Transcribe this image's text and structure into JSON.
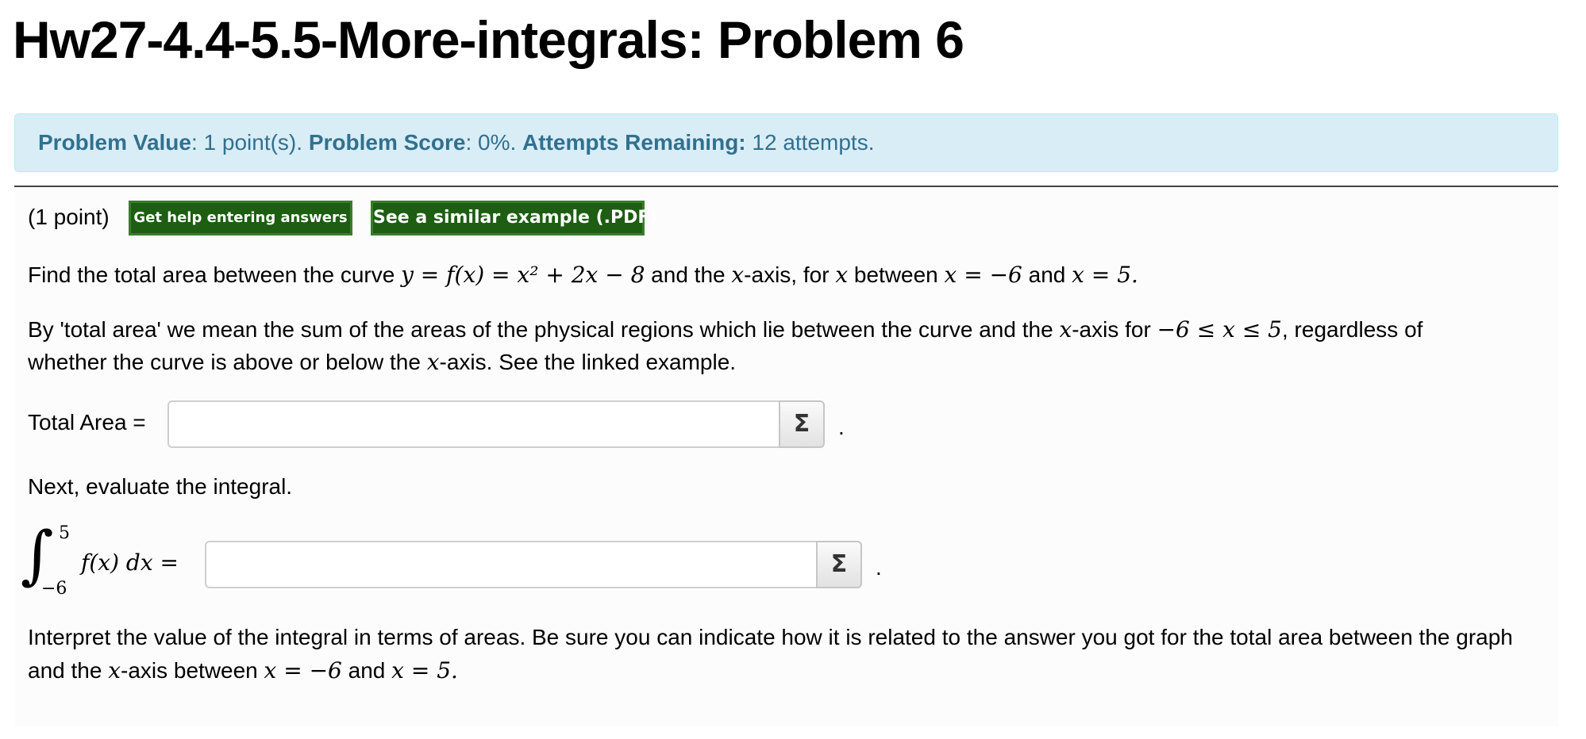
{
  "page": {
    "title": "Hw27-4.4-5.5-More-integrals: Problem 6"
  },
  "info": {
    "value_label": "Problem Value",
    "value_text": ": 1 point(s). ",
    "score_label": "Problem Score",
    "score_text": ": 0%. ",
    "attempts_label": "Attempts Remaining:",
    "attempts_text": " 12 attempts."
  },
  "problem": {
    "points": "(1 point)",
    "help_button": "Get help entering answers",
    "example_button": "See a similar example (.PDF)",
    "statement": {
      "pre": "Find the total area between the curve ",
      "formula": "y = f(x) = x² + 2x − 8",
      "mid1": " and the ",
      "x1": "x",
      "mid2": "-axis, for ",
      "x2": "x",
      "mid3": " between ",
      "eq1": "x = −6",
      "mid4": " and ",
      "eq2": "x = 5."
    },
    "def_line1_pre": "By 'total area' we mean the sum of the areas of the physical regions which lie between the curve and the ",
    "def_line1_x": "x",
    "def_line1_mid": "-axis for ",
    "def_line1_ineq": "−6 ≤ x ≤ 5",
    "def_line1_post": ", regardless of",
    "def_line2_pre": "whether the curve is above or below the ",
    "def_line2_x": "x",
    "def_line2_post": "-axis. See the linked example.",
    "total_area_label": "Total Area =",
    "next_text": "Next, evaluate the integral.",
    "integral": {
      "sign": "∫",
      "upper": "5",
      "lower": "−6",
      "integrand": "f(x) dx ="
    },
    "sigma": "Σ",
    "period": ".",
    "interp_line1": "Interpret the value of the integral in terms of areas. Be sure you can indicate how it is related to the answer you got for the total area between the graph",
    "interp_line2_pre": "and the ",
    "interp_line2_x": "x",
    "interp_line2_mid": "-axis between ",
    "interp_line2_eq1": "x = −6",
    "interp_line2_and": " and ",
    "interp_line2_eq2": "x = 5."
  },
  "colors": {
    "info_bg": "#d9edf7",
    "info_text": "#31708f",
    "button_bg": "#1d5e12"
  }
}
